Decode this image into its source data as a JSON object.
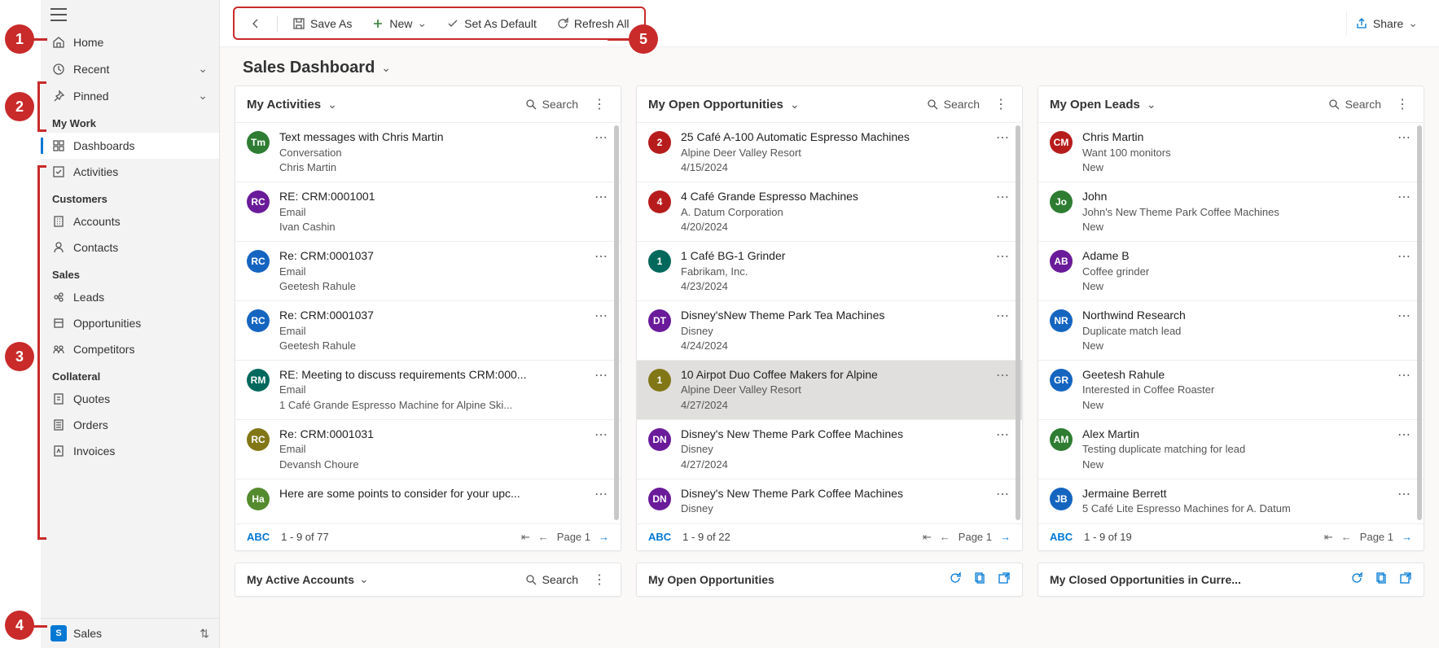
{
  "toolbar": {
    "save_as": "Save As",
    "new": "New",
    "set_default": "Set As Default",
    "refresh_all": "Refresh All",
    "share": "Share"
  },
  "page": {
    "title": "Sales Dashboard"
  },
  "sidebar": {
    "home": "Home",
    "recent": "Recent",
    "pinned": "Pinned",
    "groups": {
      "mywork": "My Work",
      "customers": "Customers",
      "sales": "Sales",
      "collateral": "Collateral"
    },
    "items": {
      "dashboards": "Dashboards",
      "activities": "Activities",
      "accounts": "Accounts",
      "contacts": "Contacts",
      "leads": "Leads",
      "opportunities": "Opportunities",
      "competitors": "Competitors",
      "quotes": "Quotes",
      "orders": "Orders",
      "invoices": "Invoices"
    },
    "footer": {
      "badge": "S",
      "label": "Sales"
    }
  },
  "labels": {
    "search": "Search",
    "page": "Page 1",
    "abc": "ABC"
  },
  "cards": {
    "activities": {
      "title": "My Activities",
      "footer": "1 - 9 of 77",
      "rows": [
        {
          "initials": "Tm",
          "color": "#2e7d32",
          "t": "Text messages with Chris Martin",
          "s1": "Conversation",
          "s2": "Chris Martin"
        },
        {
          "initials": "RC",
          "color": "#6a1b9a",
          "t": "RE: CRM:0001001",
          "s1": "Email",
          "s2": "Ivan Cashin"
        },
        {
          "initials": "RC",
          "color": "#1565c0",
          "t": "Re: CRM:0001037",
          "s1": "Email",
          "s2": "Geetesh Rahule"
        },
        {
          "initials": "RC",
          "color": "#1565c0",
          "t": "Re: CRM:0001037",
          "s1": "Email",
          "s2": "Geetesh Rahule"
        },
        {
          "initials": "RM",
          "color": "#00695c",
          "t": "RE: Meeting to discuss requirements CRM:000...",
          "s1": "Email",
          "s2": "1 Café Grande Espresso Machine for Alpine Ski..."
        },
        {
          "initials": "RC",
          "color": "#827717",
          "t": "Re: CRM:0001031",
          "s1": "Email",
          "s2": "Devansh Choure"
        },
        {
          "initials": "Ha",
          "color": "#558b2f",
          "t": "Here are some points to consider for your upc...",
          "s1": "",
          "s2": ""
        }
      ]
    },
    "opportunities": {
      "title": "My Open Opportunities",
      "footer": "1 - 9 of 22",
      "rows": [
        {
          "initials": "2",
          "color": "#b71c1c",
          "t": "25 Café A-100 Automatic Espresso Machines",
          "s1": "Alpine Deer Valley Resort",
          "s2": "4/15/2024"
        },
        {
          "initials": "4",
          "color": "#b71c1c",
          "t": "4 Café Grande Espresso Machines",
          "s1": "A. Datum Corporation",
          "s2": "4/20/2024"
        },
        {
          "initials": "1",
          "color": "#00695c",
          "t": "1 Café BG-1 Grinder",
          "s1": "Fabrikam, Inc.",
          "s2": "4/23/2024"
        },
        {
          "initials": "DT",
          "color": "#6a1b9a",
          "t": "Disney'sNew Theme Park Tea Machines",
          "s1": "Disney",
          "s2": "4/24/2024"
        },
        {
          "initials": "1",
          "color": "#827717",
          "t": "10 Airpot Duo Coffee Makers for Alpine",
          "s1": "Alpine Deer Valley Resort",
          "s2": "4/27/2024",
          "selected": true
        },
        {
          "initials": "DN",
          "color": "#6a1b9a",
          "t": "Disney's New Theme Park Coffee Machines",
          "s1": "Disney",
          "s2": "4/27/2024"
        },
        {
          "initials": "DN",
          "color": "#6a1b9a",
          "t": "Disney's New Theme Park Coffee Machines",
          "s1": "Disney",
          "s2": ""
        }
      ]
    },
    "leads": {
      "title": "My Open Leads",
      "footer": "1 - 9 of 19",
      "rows": [
        {
          "initials": "CM",
          "color": "#b71c1c",
          "t": "Chris Martin",
          "s1": "Want 100 monitors",
          "s2": "New"
        },
        {
          "initials": "Jo",
          "color": "#2e7d32",
          "t": "John",
          "s1": "John's New Theme Park Coffee Machines",
          "s2": "New"
        },
        {
          "initials": "AB",
          "color": "#6a1b9a",
          "t": "Adame B",
          "s1": "Coffee grinder",
          "s2": "New"
        },
        {
          "initials": "NR",
          "color": "#1565c0",
          "t": "Northwind Research",
          "s1": "Duplicate match lead",
          "s2": "New"
        },
        {
          "initials": "GR",
          "color": "#1565c0",
          "t": "Geetesh Rahule",
          "s1": "Interested in Coffee Roaster",
          "s2": "New"
        },
        {
          "initials": "AM",
          "color": "#2e7d32",
          "t": "Alex Martin",
          "s1": "Testing duplicate matching for lead",
          "s2": "New"
        },
        {
          "initials": "JB",
          "color": "#1565c0",
          "t": "Jermaine Berrett",
          "s1": "5 Café Lite Espresso Machines for A. Datum",
          "s2": ""
        }
      ]
    }
  },
  "cards2": {
    "a": "My Active Accounts",
    "b": "My Open Opportunities",
    "c": "My Closed Opportunities in Curre..."
  },
  "callouts": {
    "c1": "1",
    "c2": "2",
    "c3": "3",
    "c4": "4",
    "c5": "5"
  }
}
